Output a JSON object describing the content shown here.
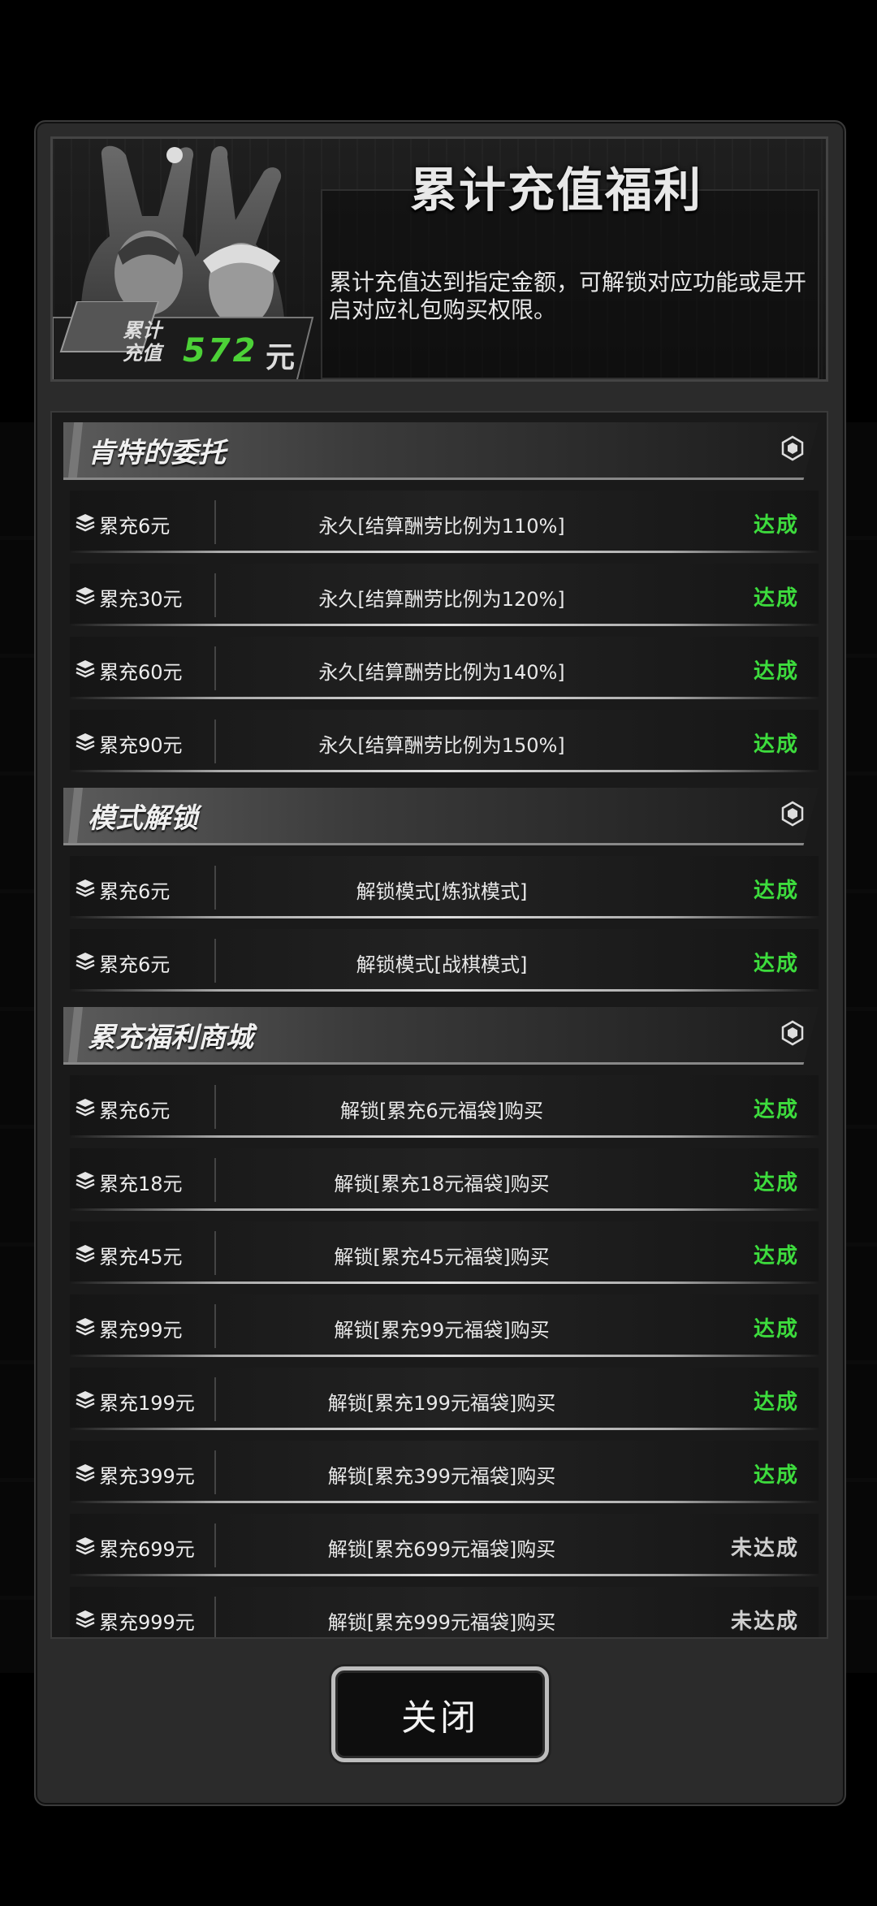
{
  "header": {
    "title": "累计充值福利",
    "description": "累计充值达到指定金额，可解锁对应功能或是开启对应礼包购买权限。",
    "total_label": "累计\n充值",
    "total_value": "572",
    "total_unit": "元"
  },
  "sections": [
    {
      "title": "肯特的委托",
      "rows": [
        {
          "amount": "累充6元",
          "reward": "永久[结算酬劳比例为110%]",
          "status": "达成"
        },
        {
          "amount": "累充30元",
          "reward": "永久[结算酬劳比例为120%]",
          "status": "达成"
        },
        {
          "amount": "累充60元",
          "reward": "永久[结算酬劳比例为140%]",
          "status": "达成"
        },
        {
          "amount": "累充90元",
          "reward": "永久[结算酬劳比例为150%]",
          "status": "达成"
        }
      ]
    },
    {
      "title": "模式解锁",
      "rows": [
        {
          "amount": "累充6元",
          "reward": "解锁模式[炼狱模式]",
          "status": "达成"
        },
        {
          "amount": "累充6元",
          "reward": "解锁模式[战棋模式]",
          "status": "达成"
        }
      ]
    },
    {
      "title": "累充福利商城",
      "rows": [
        {
          "amount": "累充6元",
          "reward": "解锁[累充6元福袋]购买",
          "status": "达成"
        },
        {
          "amount": "累充18元",
          "reward": "解锁[累充18元福袋]购买",
          "status": "达成"
        },
        {
          "amount": "累充45元",
          "reward": "解锁[累充45元福袋]购买",
          "status": "达成"
        },
        {
          "amount": "累充99元",
          "reward": "解锁[累充99元福袋]购买",
          "status": "达成"
        },
        {
          "amount": "累充199元",
          "reward": "解锁[累充199元福袋]购买",
          "status": "达成"
        },
        {
          "amount": "累充399元",
          "reward": "解锁[累充399元福袋]购买",
          "status": "达成"
        },
        {
          "amount": "累充699元",
          "reward": "解锁[累充699元福袋]购买",
          "status": "未达成"
        },
        {
          "amount": "累充999元",
          "reward": "解锁[累充999元福袋]购买",
          "status": "未达成"
        }
      ]
    }
  ],
  "close_label": "关闭",
  "colors": {
    "achieved": "#3ddc3d",
    "not_achieved": "#cfcfcf",
    "total_value": "#4cd137"
  },
  "icons": {
    "row": "layers-icon",
    "section": "hexagon-icon"
  }
}
